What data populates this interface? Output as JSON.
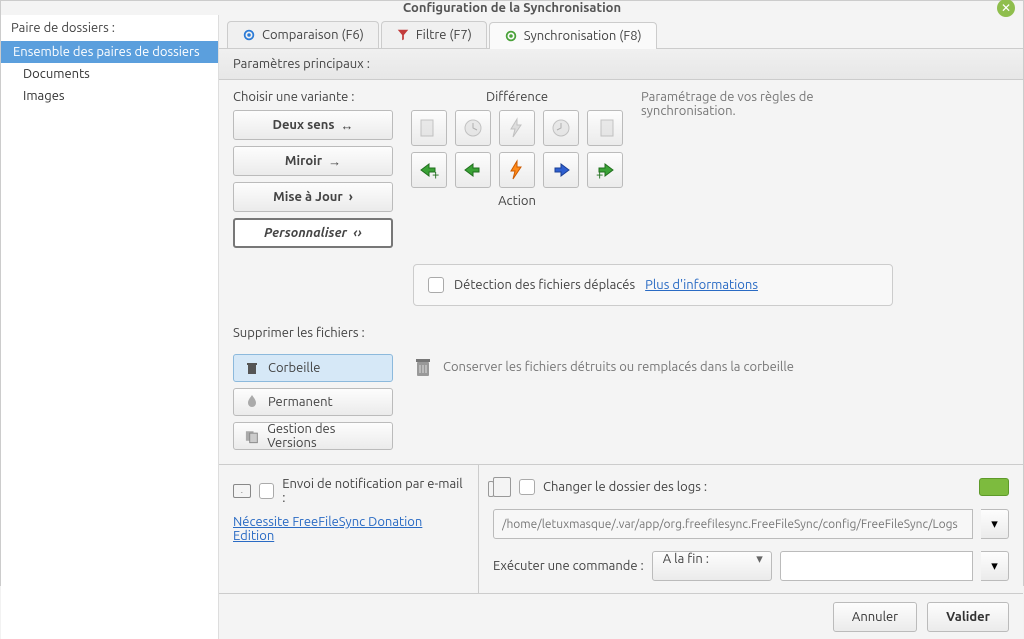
{
  "window": {
    "title": "Configuration de la Synchronisation"
  },
  "sidebar": {
    "header": "Paire de dossiers :",
    "items": [
      {
        "label": "Ensemble des paires de dossiers",
        "active": true
      },
      {
        "label": "Documents"
      },
      {
        "label": "Images"
      }
    ]
  },
  "tabs": {
    "comparison": "Comparaison (F6)",
    "filter": "Filtre (F7)",
    "sync": "Synchronisation (F8)"
  },
  "mainParams": {
    "heading": "Paramètres principaux :",
    "chooseVariant": "Choisir une variante :",
    "variants": {
      "twoway": "Deux sens",
      "mirror": "Miroir",
      "update": "Mise à Jour",
      "custom": "Personnaliser"
    },
    "difference": "Différence",
    "action": "Action",
    "helpText": "Paramétrage de vos règles de synchronisation.",
    "detectMoved": "Détection des fichiers déplacés",
    "moreInfo": "Plus d'informations"
  },
  "delete": {
    "label": "Supprimer les fichiers :",
    "trash": "Corbeille",
    "permanent": "Permanent",
    "versioning": "Gestion des Versions",
    "trashInfo": "Conserver les fichiers détruits ou remplacés dans la corbeille"
  },
  "email": {
    "label": "Envoi de notification par e-mail :",
    "donation": "Nécessite FreeFileSync Donation Edition"
  },
  "logs": {
    "changeFolder": "Changer le dossier des logs :",
    "path": "/home/letuxmasque/.var/app/org.freefilesync.FreeFileSync/config/FreeFileSync/Logs"
  },
  "execute": {
    "label": "Exécuter une commande :",
    "when": "A la fin :",
    "command": ""
  },
  "buttons": {
    "cancel": "Annuler",
    "ok": "Valider"
  }
}
